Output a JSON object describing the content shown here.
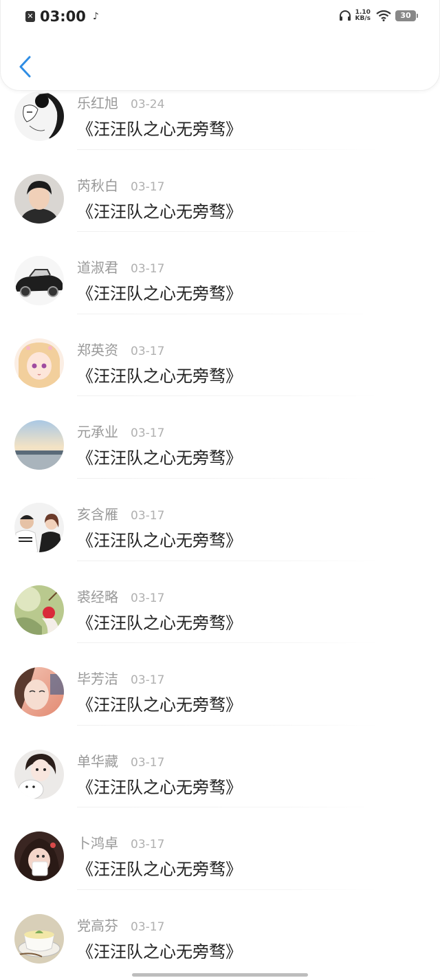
{
  "status_bar": {
    "time": "03:00",
    "speed_value": "1.10",
    "speed_unit": "KB/s",
    "battery": "30"
  },
  "colors": {
    "accent": "#2f8de4",
    "name_text": "#999999",
    "content_text": "#222222"
  },
  "list": {
    "items": [
      {
        "name": "乐红旭",
        "date": "03-24",
        "content": "《汪汪队之心无旁骛》"
      },
      {
        "name": "芮秋白",
        "date": "03-17",
        "content": "《汪汪队之心无旁骛》"
      },
      {
        "name": "道淑君",
        "date": "03-17",
        "content": "《汪汪队之心无旁骛》"
      },
      {
        "name": "郑英资",
        "date": "03-17",
        "content": "《汪汪队之心无旁骛》"
      },
      {
        "name": "元承业",
        "date": "03-17",
        "content": "《汪汪队之心无旁骛》"
      },
      {
        "name": "亥含雁",
        "date": "03-17",
        "content": "《汪汪队之心无旁骛》"
      },
      {
        "name": "裘经略",
        "date": "03-17",
        "content": "《汪汪队之心无旁骛》"
      },
      {
        "name": "毕芳洁",
        "date": "03-17",
        "content": "《汪汪队之心无旁骛》"
      },
      {
        "name": "单华藏",
        "date": "03-17",
        "content": "《汪汪队之心无旁骛》"
      },
      {
        "name": "卜鸿卓",
        "date": "03-17",
        "content": "《汪汪队之心无旁骛》"
      },
      {
        "name": "党高芬",
        "date": "03-17",
        "content": "《汪汪队之心无旁骛》"
      }
    ]
  }
}
